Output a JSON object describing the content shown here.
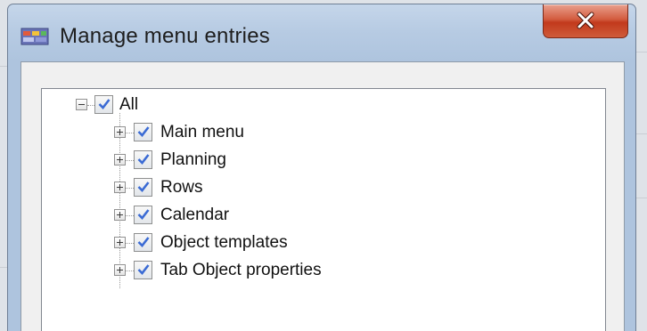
{
  "window": {
    "title": "Manage menu entries"
  },
  "tree": {
    "root": {
      "label": "All",
      "checked": true,
      "expanded": true
    },
    "children": [
      {
        "label": "Main menu",
        "checked": true,
        "expanded": false
      },
      {
        "label": "Planning",
        "checked": true,
        "expanded": false
      },
      {
        "label": "Rows",
        "checked": true,
        "expanded": false
      },
      {
        "label": "Calendar",
        "checked": true,
        "expanded": false
      },
      {
        "label": "Object templates",
        "checked": true,
        "expanded": false
      },
      {
        "label": "Tab Object properties",
        "checked": true,
        "expanded": false
      }
    ]
  },
  "icons": {
    "app": "app-window-icon",
    "close": "close-icon",
    "check": "checkmark-icon"
  },
  "colors": {
    "close_button": "#c2391c",
    "title_bar": "#b7cbe3",
    "checkmark": "#3b6bd4"
  }
}
